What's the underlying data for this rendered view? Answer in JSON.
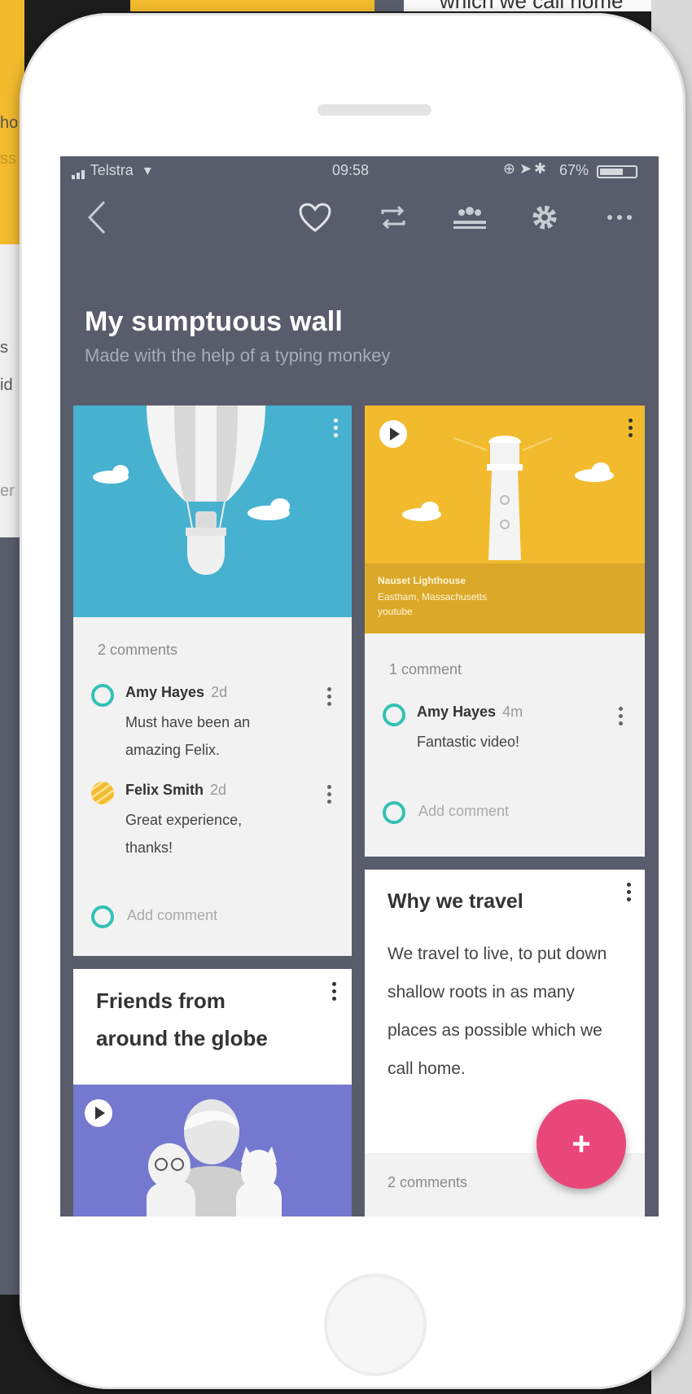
{
  "background": {
    "top_text": "which we call home",
    "left_text_a": "ho",
    "left_text_b": "ss",
    "left_text_c": "s",
    "left_text_d": "id",
    "left_text_e": "er"
  },
  "status_bar": {
    "carrier": "Telstra",
    "time": "09:58",
    "battery": "67%"
  },
  "toolbar": {
    "back_icon": "chevron-left-icon",
    "heart_icon": "heart-icon",
    "repeat_icon": "repeat-icon",
    "people_icon": "people-icon",
    "gear_icon": "gear-icon",
    "more_icon": "more-horizontal-icon"
  },
  "wall": {
    "title": "My sumptuous wall",
    "subtitle": "Made with the help of a typing monkey"
  },
  "cards": {
    "balloon": {
      "comments_count": "2 comments",
      "comments": [
        {
          "name": "Amy Hayes",
          "age": "2d",
          "text": "Must have been an amazing Felix."
        },
        {
          "name": "Felix Smith",
          "age": "2d",
          "text": "Great experience, thanks!"
        }
      ],
      "add_comment": "Add comment"
    },
    "lighthouse": {
      "caption_title": "Nauset Lighthouse",
      "caption_subtitle": "Eastham, Massachusetts",
      "caption_source": "youtube",
      "comments_count": "1 comment",
      "comments": [
        {
          "name": "Amy Hayes",
          "age": "4m",
          "text": "Fantastic video!"
        }
      ],
      "add_comment": "Add comment"
    },
    "friends": {
      "title_line1": "Friends from",
      "title_line2": "around the globe"
    },
    "travel": {
      "title": "Why we travel",
      "body": "We travel to live, to put down shallow roots in as many places as possible which we call home.",
      "comments_count": "2 comments"
    }
  },
  "fab": {
    "label": "+"
  }
}
